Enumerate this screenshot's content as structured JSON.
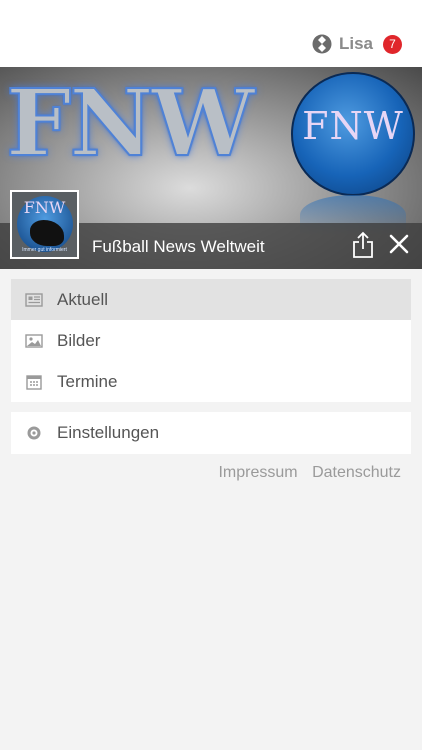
{
  "user": {
    "name": "Lisa",
    "badge": "7"
  },
  "banner": {
    "logo_text": "FNW",
    "circle_text": "FNW",
    "avatar_text": "FNW",
    "avatar_tagline": "Immer gut informiert"
  },
  "page": {
    "title": "Fußball News Weltweit"
  },
  "menu": {
    "items": [
      {
        "label": "Aktuell",
        "icon": "newspaper-icon",
        "active": true
      },
      {
        "label": "Bilder",
        "icon": "image-icon",
        "active": false
      },
      {
        "label": "Termine",
        "icon": "calendar-icon",
        "active": false
      }
    ],
    "settings_label": "Einstellungen"
  },
  "footer": {
    "impressum": "Impressum",
    "datenschutz": "Datenschutz"
  },
  "colors": {
    "badge": "#e0262b",
    "active_row": "#e2e2e2",
    "banner_blue": "#1764b8"
  }
}
